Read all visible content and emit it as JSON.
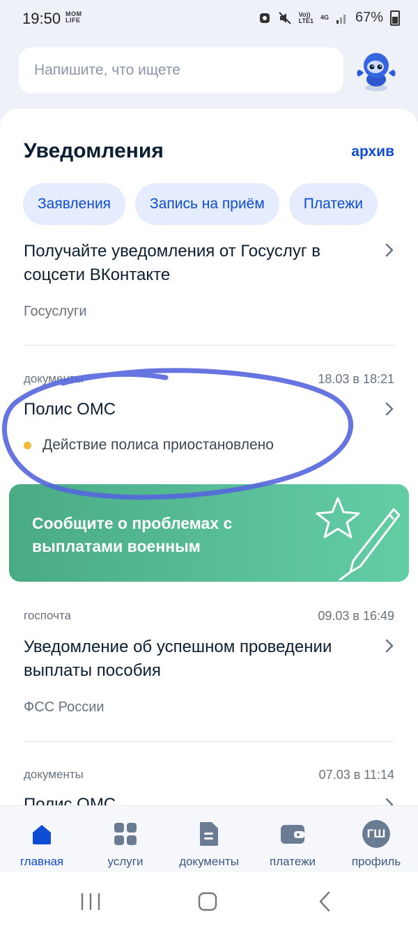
{
  "status_bar": {
    "time": "19:50",
    "app_badge": "MOM LIFE",
    "network_top": "Vo))",
    "network_bottom": "LTE1",
    "network_type": "4G",
    "battery": "67%"
  },
  "search": {
    "placeholder": "Напишите, что ищете"
  },
  "notifications": {
    "title": "Уведомления",
    "archive_label": "архив",
    "chips": [
      "Заявления",
      "Запись на приём",
      "Платежи"
    ],
    "items": [
      {
        "title": "Получайте уведомления от Госуслуг в соцсети ВКонтакте",
        "subtitle": "Госуслуги"
      },
      {
        "category": "документы",
        "date": "18.03 в 18:21",
        "title": "Полис ОМС",
        "status": "Действие полиса приостановлено"
      },
      {
        "category": "госпочта",
        "date": "09.03 в 16:49",
        "title": "Уведомление об успешном проведении выплаты пособия",
        "subtitle": "ФСС России"
      },
      {
        "category": "документы",
        "date": "07.03 в 11:14",
        "title": "Полис ОМС"
      }
    ]
  },
  "promo": {
    "text": "Сообщите о проблемах с выплатами военным"
  },
  "bottom_nav": {
    "items": [
      {
        "label": "главная",
        "icon": "home-icon"
      },
      {
        "label": "услуги",
        "icon": "grid-icon"
      },
      {
        "label": "документы",
        "icon": "document-icon"
      },
      {
        "label": "платежи",
        "icon": "wallet-icon"
      },
      {
        "label": "профиль",
        "icon": "avatar",
        "initials": "ГШ"
      }
    ]
  },
  "colors": {
    "accent": "#0d4cd3",
    "promo_green": "#52b890",
    "status_warning": "#f0b93c",
    "annotation_circle": "#5061d8"
  }
}
